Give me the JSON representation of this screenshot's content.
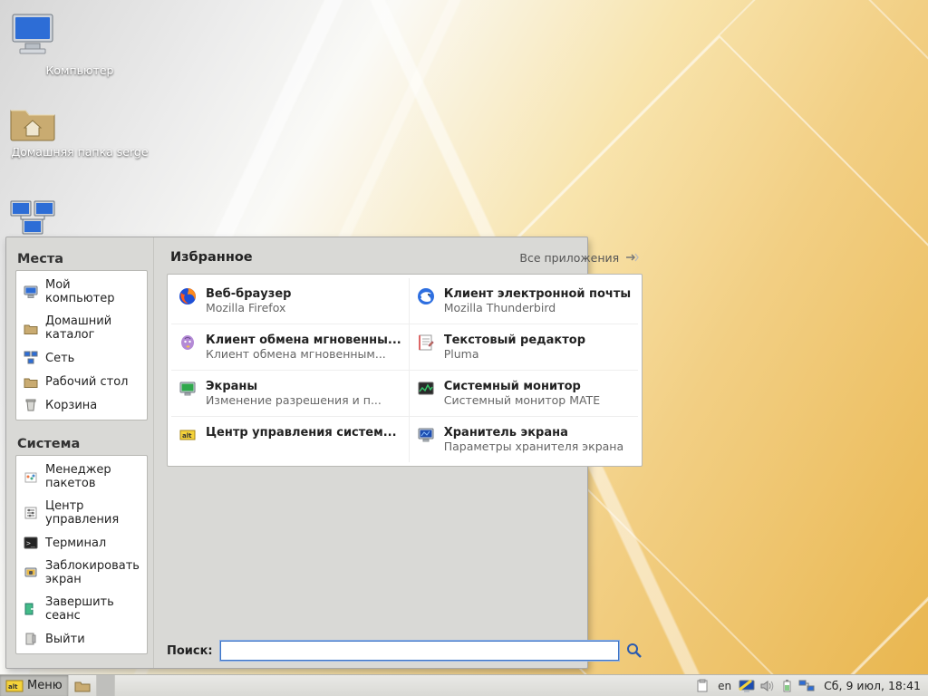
{
  "desktop": {
    "icons": [
      {
        "label": "Компьютер"
      },
      {
        "label": "Домашняя папка serge"
      },
      {
        "label": ""
      }
    ]
  },
  "menu": {
    "places_title": "Места",
    "places": [
      {
        "label": "Мой компьютер"
      },
      {
        "label": "Домашний каталог"
      },
      {
        "label": "Сеть"
      },
      {
        "label": "Рабочий стол"
      },
      {
        "label": "Корзина"
      }
    ],
    "system_title": "Система",
    "system": [
      {
        "label": "Менеджер пакетов"
      },
      {
        "label": "Центр управления"
      },
      {
        "label": "Терминал"
      },
      {
        "label": "Заблокировать экран"
      },
      {
        "label": "Завершить сеанс"
      },
      {
        "label": "Выйти"
      }
    ],
    "favorites_title": "Избранное",
    "all_apps_label": "Все приложения",
    "favorites": [
      {
        "title": "Веб-браузер",
        "sub": "Mozilla Firefox"
      },
      {
        "title": "Клиент электронной почты",
        "sub": "Mozilla Thunderbird"
      },
      {
        "title": "Клиент обмена мгновенны...",
        "sub": "Клиент обмена мгновенным..."
      },
      {
        "title": "Текстовый редактор",
        "sub": "Pluma"
      },
      {
        "title": "Экраны",
        "sub": "Изменение разрешения и п..."
      },
      {
        "title": "Системный монитор",
        "sub": "Системный монитор MATE"
      },
      {
        "title": "Центр управления систем...",
        "sub": ""
      },
      {
        "title": "Хранитель экрана",
        "sub": "Параметры хранителя экрана"
      }
    ],
    "search_label": "Поиск:",
    "search_value": ""
  },
  "taskbar": {
    "menu_label": "Меню",
    "lang": "en",
    "clock": "Сб,  9 июл, 18:41"
  }
}
